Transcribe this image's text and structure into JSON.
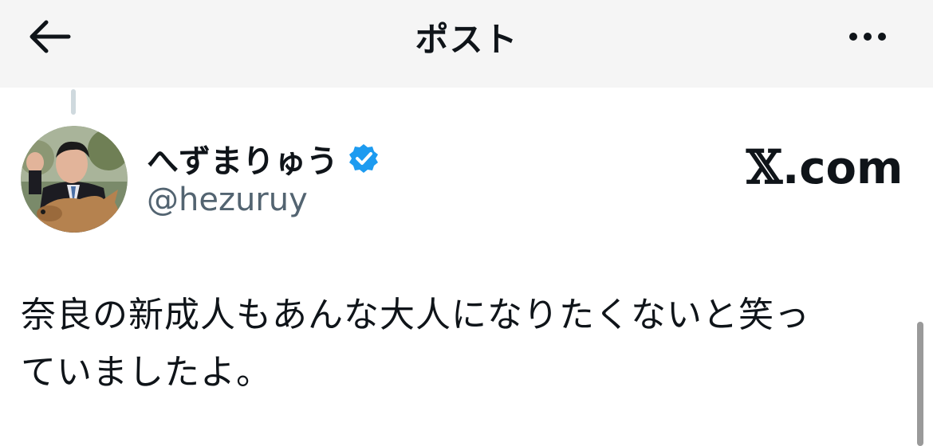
{
  "header": {
    "title": "ポスト",
    "back_icon": "arrow-left-icon",
    "more_icon": "more-horizontal-icon"
  },
  "author": {
    "display_name": "へずまりゅう",
    "verified": true,
    "verified_color": "#1d9bf0",
    "handle": "@hezuruy",
    "avatar_icon": "profile-photo"
  },
  "watermark": {
    "x_symbol": "𝕏",
    "text": ".com"
  },
  "post": {
    "text": "奈良の新成人もあんな大人になりたくないと笑っ\nていましたよ。"
  },
  "colors": {
    "header_bg": "#f5f5f5",
    "text": "#0f1419",
    "secondary_text": "#536471",
    "thread_line": "#cfd9de"
  }
}
